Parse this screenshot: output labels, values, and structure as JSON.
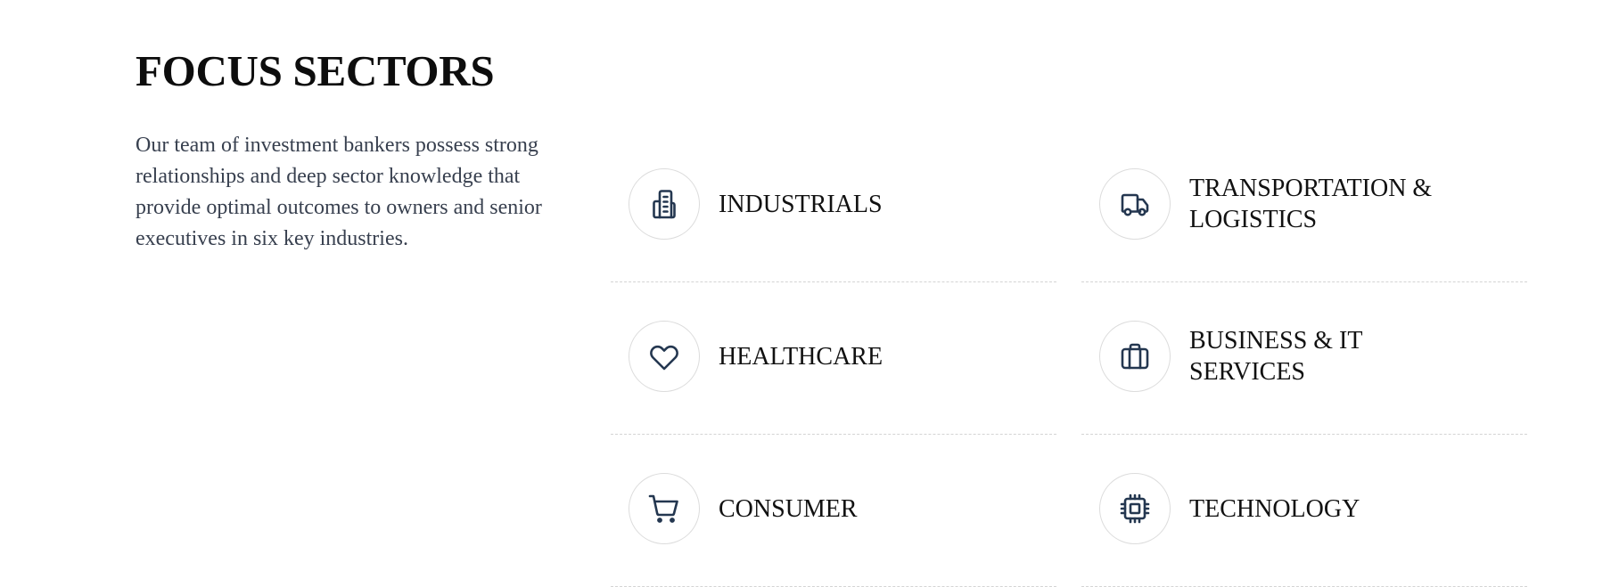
{
  "section": {
    "title": "FOCUS SECTORS",
    "description": "Our team of investment bankers possess strong relationships and deep sector knowledge that provide optimal outcomes to owners and senior executives in six key industries."
  },
  "colors": {
    "icon_stroke": "#243750",
    "divider": "#d4d4d4",
    "icon_circle_border": "#dcdcdc",
    "body_text": "#38404f",
    "heading_text": "#0d0d0d"
  },
  "sectors": [
    {
      "label": "INDUSTRIALS",
      "icon": "building-icon"
    },
    {
      "label": "TRANSPORTATION & LOGISTICS",
      "icon": "truck-icon"
    },
    {
      "label": "HEALTHCARE",
      "icon": "heart-icon"
    },
    {
      "label": "BUSINESS & IT SERVICES",
      "icon": "briefcase-icon"
    },
    {
      "label": "CONSUMER",
      "icon": "shopping-cart-icon"
    },
    {
      "label": "TECHNOLOGY",
      "icon": "cpu-chip-icon"
    }
  ]
}
